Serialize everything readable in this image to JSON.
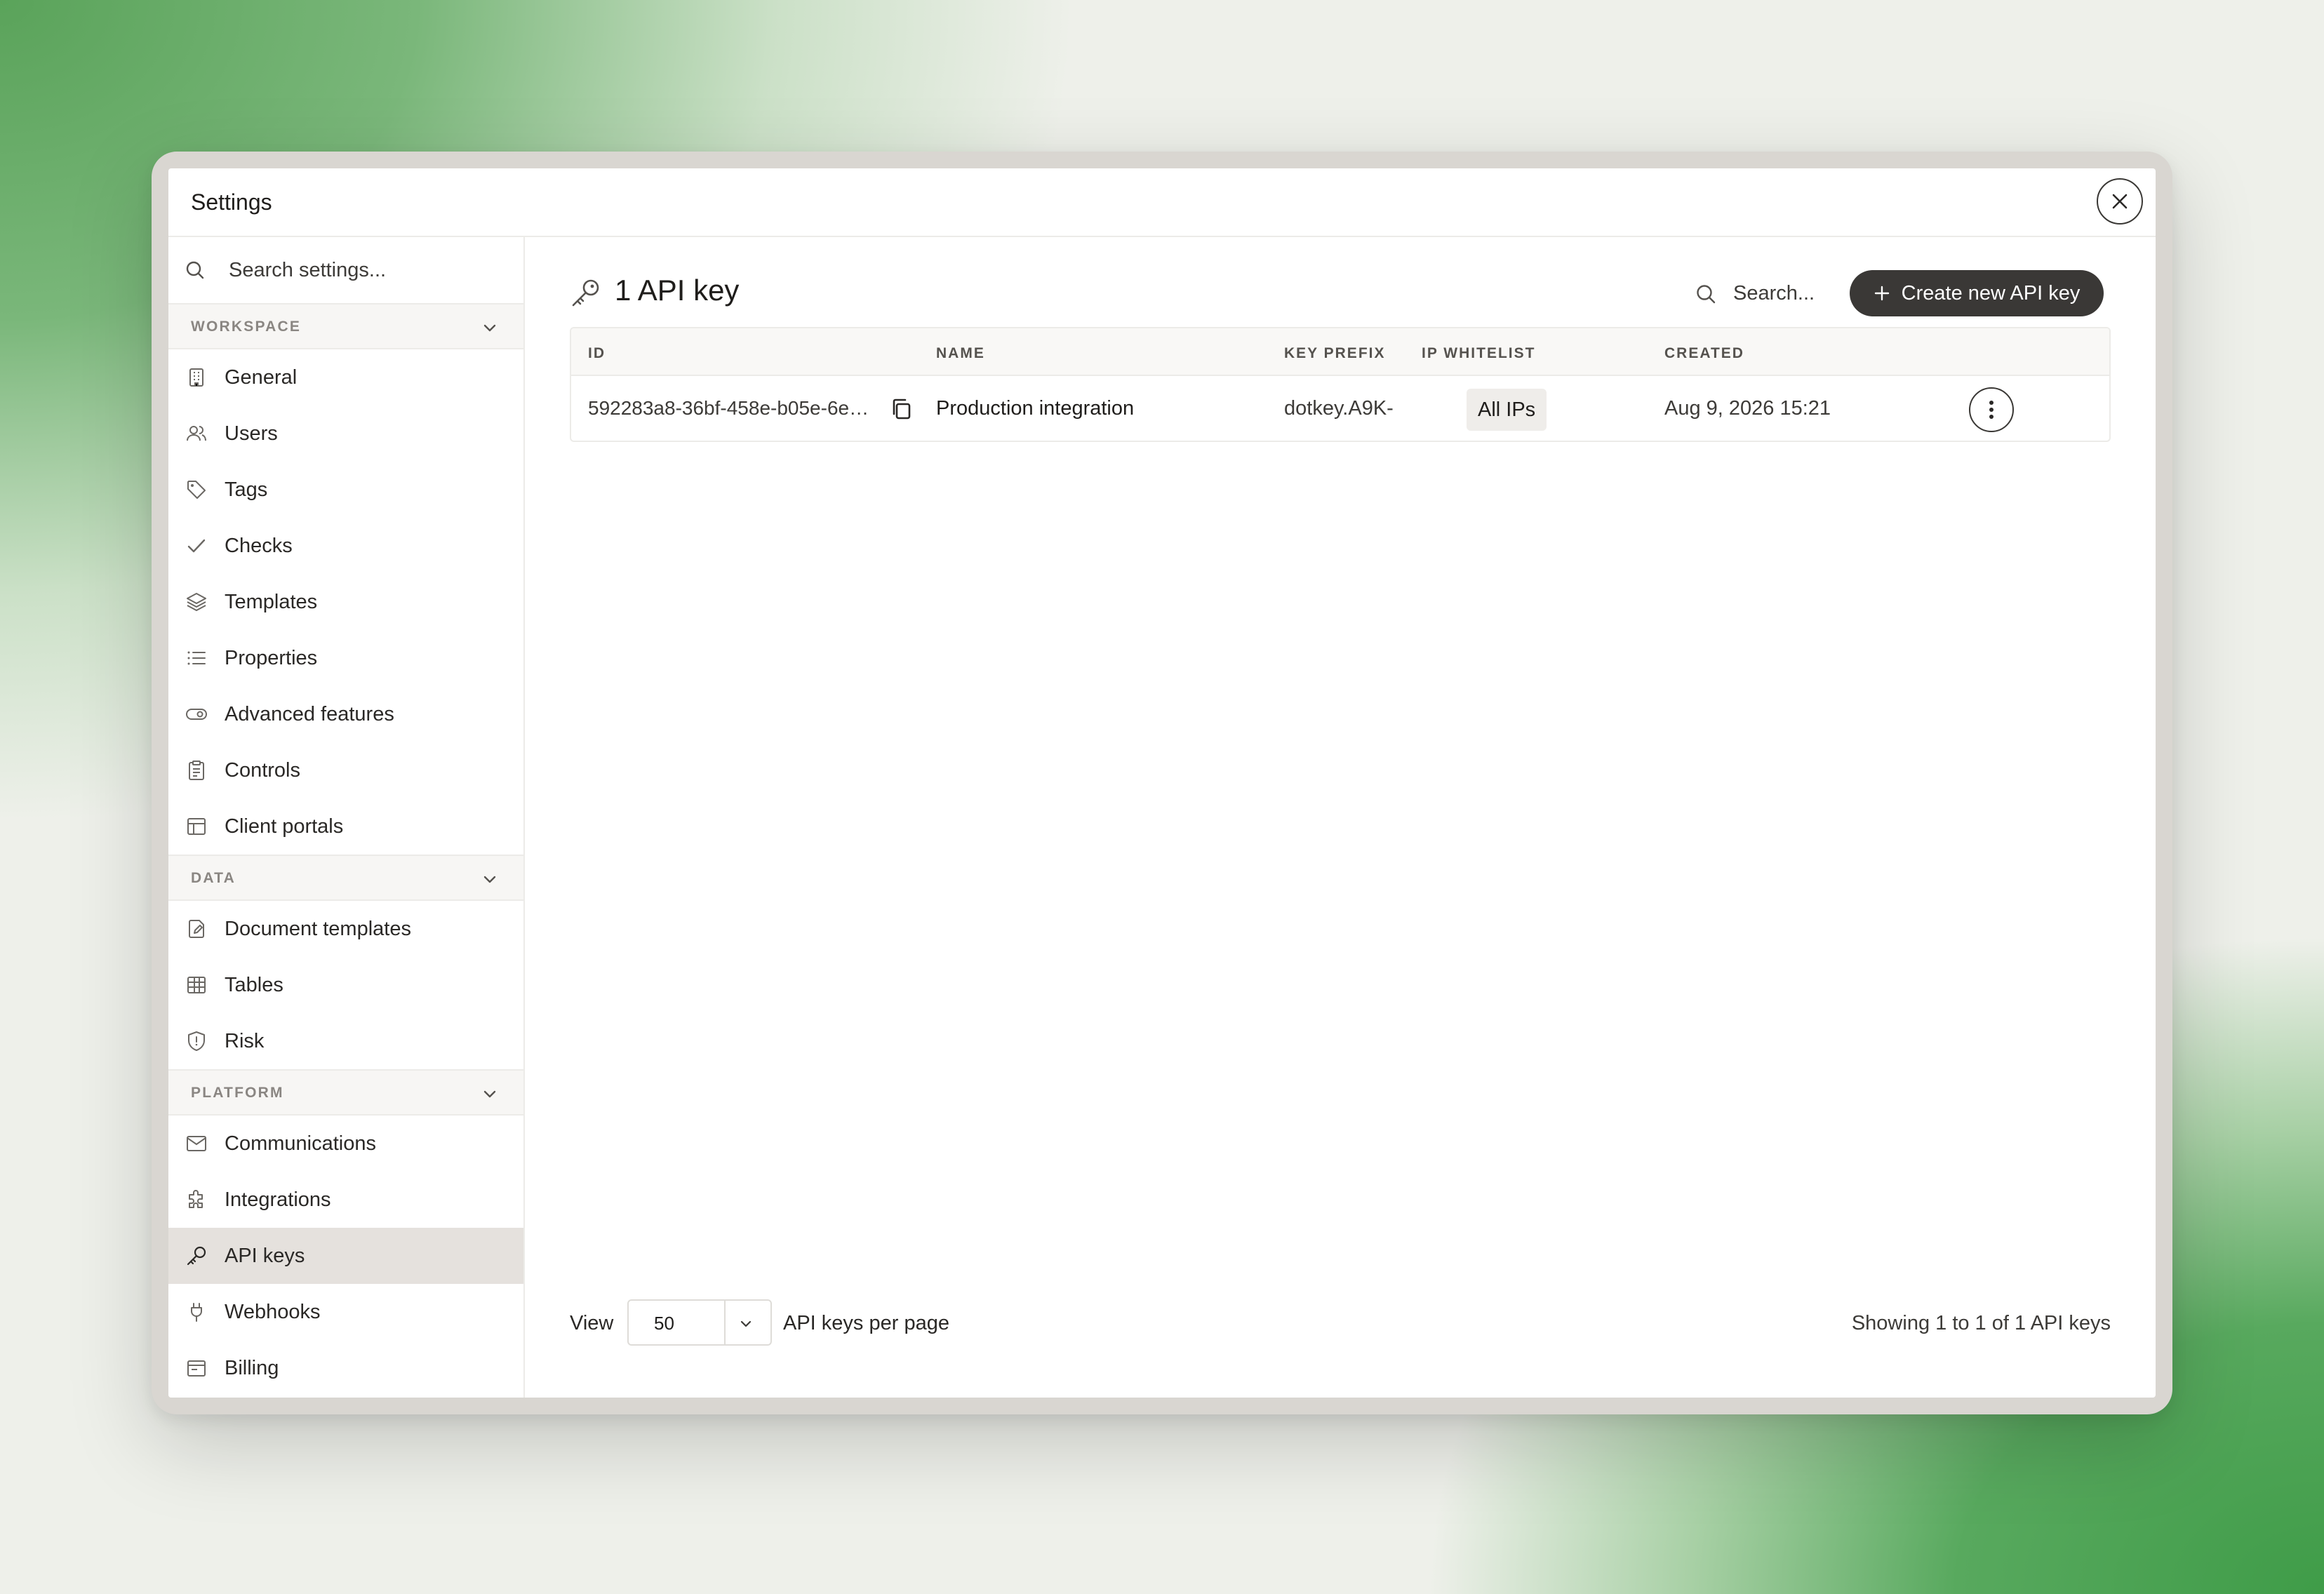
{
  "window": {
    "title": "Settings"
  },
  "sidebar": {
    "search_placeholder": "Search settings...",
    "sections": [
      {
        "label": "WORKSPACE",
        "items": [
          {
            "label": "General",
            "icon": "building-icon"
          },
          {
            "label": "Users",
            "icon": "users-icon"
          },
          {
            "label": "Tags",
            "icon": "tag-icon"
          },
          {
            "label": "Checks",
            "icon": "check-icon"
          },
          {
            "label": "Templates",
            "icon": "layers-icon"
          },
          {
            "label": "Properties",
            "icon": "list-icon"
          },
          {
            "label": "Advanced features",
            "icon": "toggle-icon"
          },
          {
            "label": "Controls",
            "icon": "clipboard-icon"
          },
          {
            "label": "Client portals",
            "icon": "layout-icon"
          }
        ]
      },
      {
        "label": "DATA",
        "items": [
          {
            "label": "Document templates",
            "icon": "file-edit-icon"
          },
          {
            "label": "Tables",
            "icon": "table-icon"
          },
          {
            "label": "Risk",
            "icon": "shield-icon"
          }
        ]
      },
      {
        "label": "PLATFORM",
        "items": [
          {
            "label": "Communications",
            "icon": "mail-icon"
          },
          {
            "label": "Integrations",
            "icon": "puzzle-icon"
          },
          {
            "label": "API keys",
            "icon": "key-icon",
            "active": true
          },
          {
            "label": "Webhooks",
            "icon": "plug-icon"
          },
          {
            "label": "Billing",
            "icon": "receipt-icon"
          }
        ]
      }
    ]
  },
  "main": {
    "heading": "1 API key",
    "heading_icon": "key-icon",
    "search_placeholder": "Search...",
    "create_button": "Create new API key",
    "table": {
      "columns": [
        "ID",
        "NAME",
        "KEY PREFIX",
        "IP WHITELIST",
        "CREATED"
      ],
      "rows": [
        {
          "id": "592283a8-36bf-458e-b05e-6e…",
          "name": "Production integration",
          "key_prefix": "dotkey.A9K-",
          "ip_whitelist": "All IPs",
          "created": "Aug 9, 2026 15:21"
        }
      ]
    },
    "footer": {
      "view_label": "View",
      "per_page": "50",
      "per_page_suffix": "API keys per page",
      "showing": "Showing 1 to 1 of 1 API keys"
    }
  },
  "colors": {
    "accent_button": "#3a3836",
    "active_nav": "#e5e1dd"
  }
}
